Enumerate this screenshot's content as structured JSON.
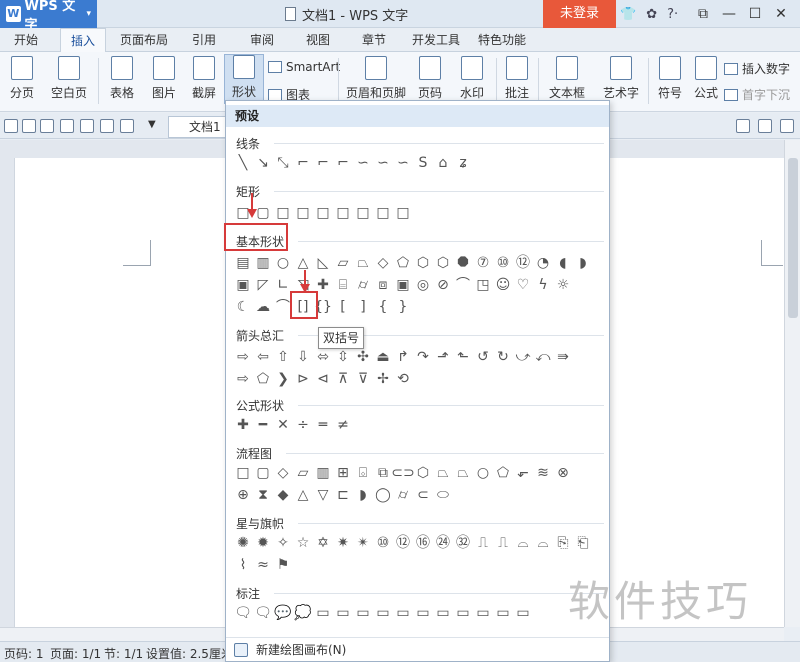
{
  "app": {
    "name": "WPS 文字",
    "logo_letter": "W",
    "window_title": "文档1 - WPS 文字",
    "login_button": "未登录"
  },
  "menu": {
    "tabs": [
      "开始",
      "插入",
      "页面布局",
      "引用",
      "审阅",
      "视图",
      "章节",
      "开发工具",
      "特色功能"
    ],
    "active_tab": "插入"
  },
  "ribbon": {
    "page_break": "分页",
    "blank_page": "空白页",
    "table": "表格",
    "picture": "图片",
    "screenshot": "截屏",
    "shape": "形状",
    "smartart": "SmartArt",
    "chart": "图表",
    "header_footer": "页眉和页脚",
    "page_number": "页码",
    "watermark": "水印",
    "comment": "批注",
    "text_box": "文本框",
    "wordart": "艺术字",
    "symbol": "符号",
    "formula": "公式",
    "insert_number": "插入数字",
    "drop_cap": "首字下沉"
  },
  "doc_tab": {
    "name": "文档1"
  },
  "shapes_menu": {
    "preset_header": "预设",
    "categories": {
      "lines": "线条",
      "rectangles": "矩形",
      "basic": "基本形状",
      "arrows": "箭头总汇",
      "equation": "公式形状",
      "flowchart": "流程图",
      "stars": "星与旗帜",
      "callouts": "标注"
    },
    "tooltip": "双括号",
    "new_canvas": "新建绘图画布(N)"
  },
  "status": {
    "page_code": "页码: 1",
    "page": "页面: 1/1",
    "section": "节: 1/1",
    "setting": "设置值: 2.5厘米"
  },
  "watermark_text": "软件技巧",
  "colors": {
    "accent": "#3b7bd0",
    "login": "#e8583a",
    "annotation": "#d63a3a"
  }
}
